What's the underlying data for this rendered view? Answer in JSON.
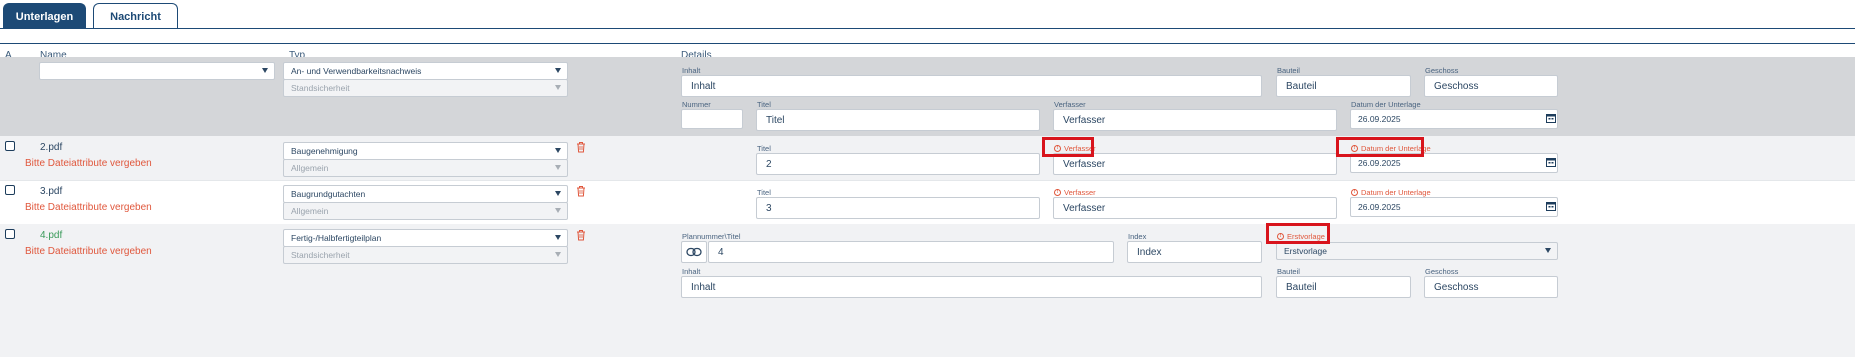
{
  "tabs": [
    {
      "label": "Unterlagen",
      "active": true
    },
    {
      "label": "Nachricht",
      "active": false
    }
  ],
  "columns": {
    "a": "A",
    "name": "Name",
    "typ": "Typ",
    "details": "Details"
  },
  "filter": {
    "name_value": "",
    "typ_value": "An- und Verwendbarkeitsnachweis",
    "subtyp_value": "Standsicherheit",
    "labels": {
      "inhalt": "Inhalt",
      "bauteil": "Bauteil",
      "geschoss": "Geschoss",
      "nummer": "Nummer",
      "titel": "Titel",
      "verfasser": "Verfasser",
      "datum": "Datum der Unterlage"
    },
    "placeholders": {
      "inhalt": "Inhalt",
      "bauteil": "Bauteil",
      "geschoss": "Geschoss",
      "nummer": "",
      "titel": "Titel",
      "verfasser": "Verfasser"
    },
    "datum_value": "26.09.2025"
  },
  "rows": [
    {
      "filename": "2.pdf",
      "hint": "Bitte Dateiattribute vergeben",
      "typ": "Baugenehmigung",
      "subtyp": "Allgemein",
      "titel_label": "Titel",
      "titel_value": "2",
      "verfasser_label": "Verfasser",
      "verfasser_placeholder": "Verfasser",
      "datum_label": "Datum der Unterlage",
      "datum_value": "26.09.2025"
    },
    {
      "filename": "3.pdf",
      "hint": "Bitte Dateiattribute vergeben",
      "typ": "Baugrundgutachten",
      "subtyp": "Allgemein",
      "titel_label": "Titel",
      "titel_value": "3",
      "verfasser_label": "Verfasser",
      "verfasser_placeholder": "Verfasser",
      "datum_label": "Datum der Unterlage",
      "datum_value": "26.09.2025"
    },
    {
      "filename": "4.pdf",
      "hint": "Bitte Dateiattribute vergeben",
      "typ": "Fertig-/Halbfertigteilplan",
      "subtyp": "Standsicherheit",
      "plan_label": "Plannummer\\Titel",
      "plan_value": "4",
      "index_label": "Index",
      "index_placeholder": "Index",
      "erst_label": "Erstvorlage",
      "erst_value": "Erstvorlage",
      "inhalt_label": "Inhalt",
      "inhalt_placeholder": "Inhalt",
      "bauteil_label": "Bauteil",
      "bauteil_placeholder": "Bauteil",
      "geschoss_label": "Geschoss",
      "geschoss_placeholder": "Geschoss"
    }
  ],
  "colors": {
    "primary": "#1d4a76",
    "error": "#e0573c",
    "filter_bg": "#d4d6d9",
    "row_alt_bg": "#f1f2f4",
    "highlight": "#d8141c"
  }
}
